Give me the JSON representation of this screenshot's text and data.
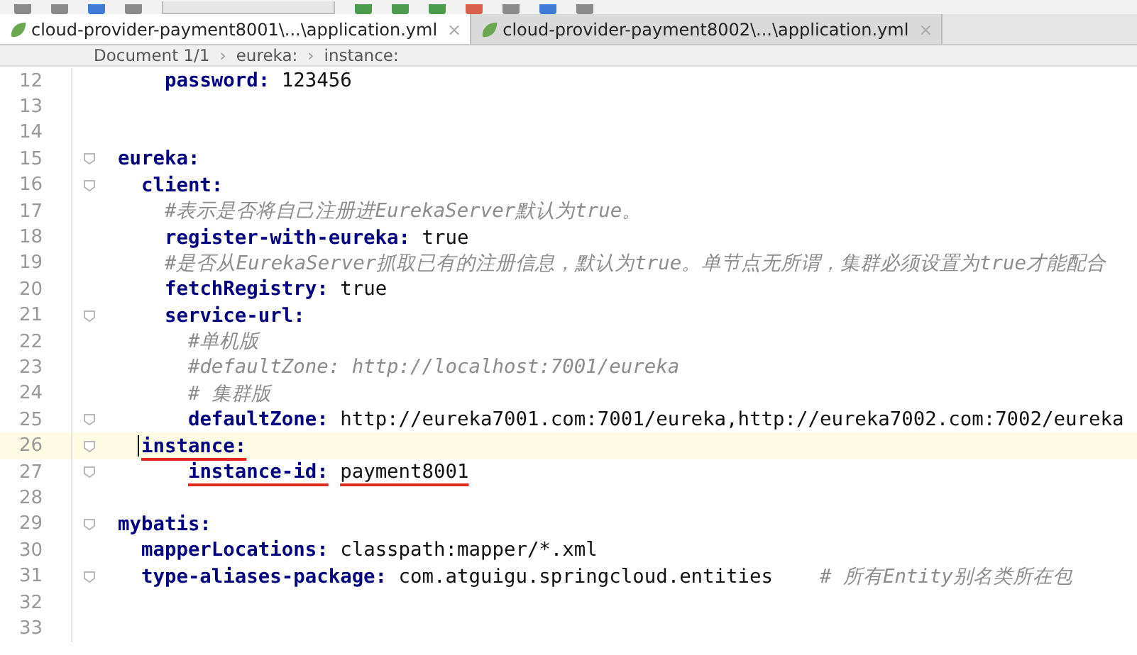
{
  "tabs": [
    {
      "label": "cloud-provider-payment8001\\...\\application.yml",
      "close": "×",
      "selected": true
    },
    {
      "label": "cloud-provider-payment8002\\...\\application.yml",
      "close": "×",
      "selected": false
    }
  ],
  "breadcrumb": [
    {
      "kind": "crumb",
      "text": "Document 1/1"
    },
    {
      "kind": "separator",
      "text": "›"
    },
    {
      "kind": "crumb",
      "text": "eureka:"
    },
    {
      "kind": "separator",
      "text": "›"
    },
    {
      "kind": "crumb",
      "text": "instance:"
    }
  ],
  "lines": [
    {
      "number": "12",
      "fold": false,
      "current": false,
      "underlined": false,
      "tokens": [
        {
          "kind": "key",
          "text": "    password:"
        },
        {
          "kind": "value",
          "text": " 123456"
        }
      ]
    },
    {
      "number": "13",
      "fold": false,
      "current": false
    },
    {
      "number": "14",
      "fold": false,
      "current": false
    },
    {
      "number": "15",
      "fold": true,
      "current": false,
      "underlined": false,
      "tokens": [
        {
          "kind": "key",
          "text": "eureka:"
        }
      ]
    },
    {
      "number": "16",
      "fold": true,
      "current": false,
      "underlined": false,
      "tokens": [
        {
          "kind": "key",
          "text": "  client:"
        }
      ]
    },
    {
      "number": "17",
      "fold": false,
      "current": false,
      "underlined": false,
      "tokens": [
        {
          "kind": "comment",
          "text": "    #表示是否将自己注册进EurekaServer默认为true。"
        }
      ]
    },
    {
      "number": "18",
      "fold": false,
      "current": false,
      "underlined": false,
      "tokens": [
        {
          "kind": "key",
          "text": "    register-with-eureka:"
        },
        {
          "kind": "value",
          "text": " true"
        }
      ]
    },
    {
      "number": "19",
      "fold": false,
      "current": false,
      "underlined": false,
      "tokens": [
        {
          "kind": "comment",
          "text": "    #是否从EurekaServer抓取已有的注册信息，默认为true。单节点无所谓，集群必须设置为true才能配合"
        }
      ]
    },
    {
      "number": "20",
      "fold": false,
      "current": false,
      "underlined": false,
      "tokens": [
        {
          "kind": "key",
          "text": "    fetchRegistry:"
        },
        {
          "kind": "value",
          "text": " true"
        }
      ]
    },
    {
      "number": "21",
      "fold": true,
      "current": false,
      "underlined": false,
      "tokens": [
        {
          "kind": "key",
          "text": "    service-url:"
        }
      ]
    },
    {
      "number": "22",
      "fold": false,
      "current": false,
      "underlined": false,
      "tokens": [
        {
          "kind": "comment",
          "text": "      #单机版"
        }
      ]
    },
    {
      "number": "23",
      "fold": false,
      "current": false,
      "underlined": false,
      "tokens": [
        {
          "kind": "comment",
          "text": "      #defaultZone: http://localhost:7001/eureka"
        }
      ]
    },
    {
      "number": "24",
      "fold": false,
      "current": false,
      "underlined": false,
      "tokens": [
        {
          "kind": "comment",
          "text": "      # 集群版"
        }
      ]
    },
    {
      "number": "25",
      "fold": true,
      "current": false,
      "underlined": false,
      "tokens": [
        {
          "kind": "key",
          "text": "      defaultZone:"
        },
        {
          "kind": "value",
          "text": " http://eureka7001.com:7001/eureka,http://eureka7002.com:7002/eureka"
        }
      ]
    },
    {
      "number": "26",
      "fold": true,
      "current": true,
      "underlined": true,
      "tokens": [
        {
          "kind": "key",
          "text": "  instance:"
        }
      ]
    },
    {
      "number": "27",
      "fold": true,
      "current": false,
      "underlined": true,
      "tokens": [
        {
          "kind": "key",
          "text": "      instance-id:"
        },
        {
          "kind": "value",
          "text": " payment8001"
        }
      ]
    },
    {
      "number": "28",
      "fold": false,
      "current": false
    },
    {
      "number": "29",
      "fold": true,
      "current": false,
      "underlined": false,
      "tokens": [
        {
          "kind": "key",
          "text": "mybatis:"
        }
      ]
    },
    {
      "number": "30",
      "fold": false,
      "current": false,
      "underlined": false,
      "tokens": [
        {
          "kind": "key",
          "text": "  mapperLocations:"
        },
        {
          "kind": "value",
          "text": " classpath:mapper/*.xml"
        }
      ]
    },
    {
      "number": "31",
      "fold": true,
      "current": false,
      "underlined": false,
      "tokens": [
        {
          "kind": "key",
          "text": "  type-aliases-package:"
        },
        {
          "kind": "value",
          "text": " com.atguigu.springcloud.entities"
        },
        {
          "kind": "comment",
          "text": "    # 所有Entity别名类所在包"
        }
      ]
    },
    {
      "number": "32",
      "fold": false,
      "current": false
    },
    {
      "number": "33",
      "fold": false,
      "current": false
    }
  ]
}
